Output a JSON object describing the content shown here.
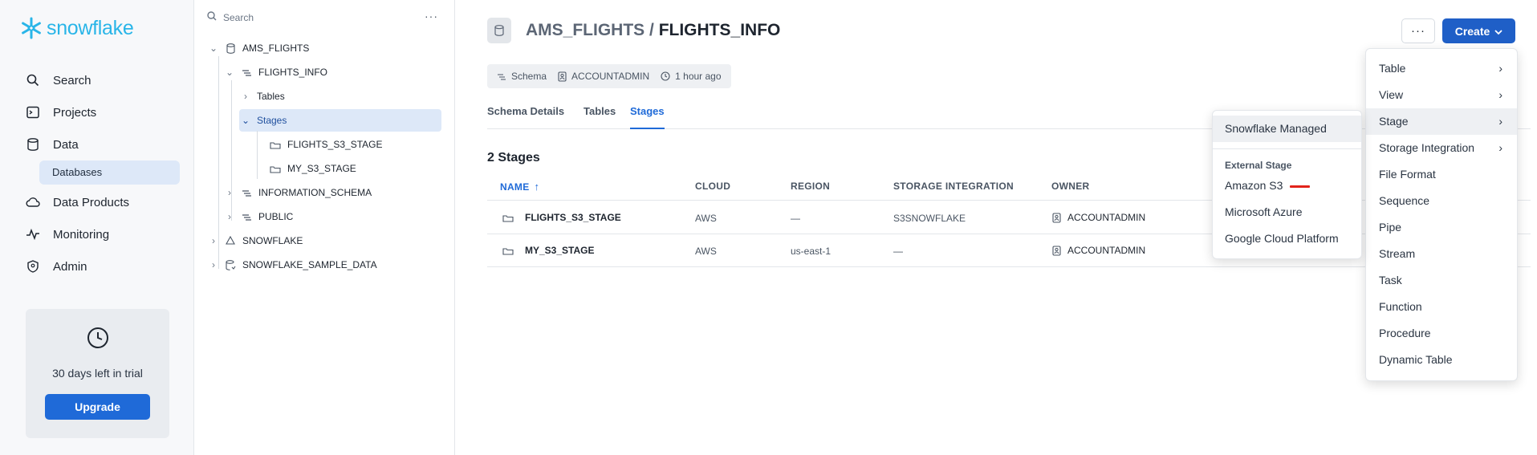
{
  "brand": {
    "logo_text": "snowflake",
    "accent": "#29b5e8",
    "primary_button": "#1f5fc7"
  },
  "leftnav": {
    "items": [
      {
        "label": "Search",
        "icon": "search-icon"
      },
      {
        "label": "Projects",
        "icon": "terminal-icon"
      },
      {
        "label": "Data",
        "icon": "database-icon"
      },
      {
        "label": "Data Products",
        "icon": "cloud-icon"
      },
      {
        "label": "Monitoring",
        "icon": "activity-icon"
      },
      {
        "label": "Admin",
        "icon": "shield-icon"
      }
    ],
    "sub_item": "Databases",
    "trial": {
      "text": "30 days left in trial",
      "button": "Upgrade"
    }
  },
  "tree": {
    "search_placeholder": "Search",
    "more": "···",
    "rows": [
      {
        "label": "AMS_FLIGHTS",
        "icon": "database-icon"
      },
      {
        "label": "FLIGHTS_INFO",
        "icon": "schema-icon"
      },
      {
        "label": "Tables"
      },
      {
        "label": "Stages"
      },
      {
        "label": "FLIGHTS_S3_STAGE",
        "icon": "stage-icon"
      },
      {
        "label": "MY_S3_STAGE",
        "icon": "stage-icon"
      },
      {
        "label": "INFORMATION_SCHEMA",
        "icon": "schema-icon"
      },
      {
        "label": "PUBLIC",
        "icon": "schema-icon"
      },
      {
        "label": "SNOWFLAKE",
        "icon": "shared-db-icon"
      },
      {
        "label": "SNOWFLAKE_SAMPLE_DATA",
        "icon": "shared-db-icon"
      }
    ]
  },
  "main": {
    "title_db": "AMS_FLIGHTS / ",
    "title_schema": "FLIGHTS_INFO",
    "meta": {
      "type": "Schema",
      "owner": "ACCOUNTADMIN",
      "time": "1 hour ago"
    },
    "tabs": [
      "Schema Details",
      "Tables",
      "Stages"
    ],
    "count": "2 Stages",
    "columns": [
      "NAME",
      "CLOUD",
      "REGION",
      "STORAGE INTEGRATION",
      "OWNER"
    ],
    "sort_arrow": "↑",
    "rows": [
      {
        "name": "FLIGHTS_S3_STAGE",
        "cloud": "AWS",
        "region": "—",
        "integration": "S3SNOWFLAKE",
        "owner": "ACCOUNTADMIN"
      },
      {
        "name": "MY_S3_STAGE",
        "cloud": "AWS",
        "region": "us-east-1",
        "integration": "—",
        "owner": "ACCOUNTADMIN"
      }
    ],
    "more_button": "···",
    "create_button": "Create"
  },
  "create_menu": {
    "items": [
      {
        "label": "Table",
        "arrow": "›"
      },
      {
        "label": "View",
        "arrow": "›"
      },
      {
        "label": "Stage",
        "arrow": "›"
      },
      {
        "label": "Storage Integration",
        "arrow": "›"
      },
      {
        "label": "File Format"
      },
      {
        "label": "Sequence"
      },
      {
        "label": "Pipe"
      },
      {
        "label": "Stream"
      },
      {
        "label": "Task"
      },
      {
        "label": "Function"
      },
      {
        "label": "Procedure"
      },
      {
        "label": "Dynamic Table"
      }
    ]
  },
  "stage_menu": {
    "managed": "Snowflake Managed",
    "external_header": "External Stage",
    "external": [
      "Amazon S3",
      "Microsoft Azure",
      "Google Cloud Platform"
    ]
  }
}
